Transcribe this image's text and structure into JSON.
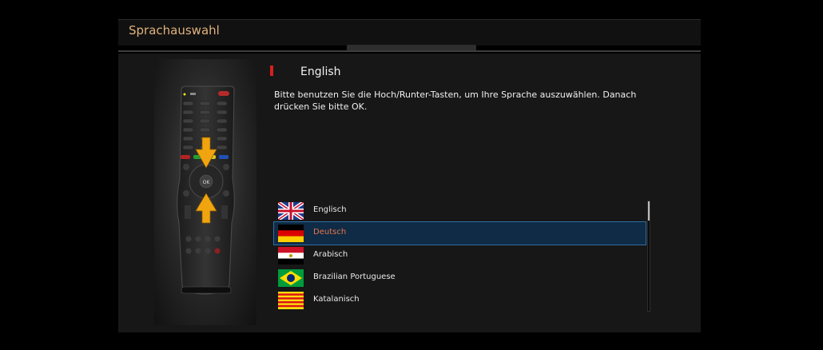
{
  "window": {
    "title": "Sprachauswahl"
  },
  "selected_language": {
    "name": "English"
  },
  "instructions": "Bitte benutzen Sie die Hoch/Runter-Tasten, um Ihre Sprache auszuwählen. Danach drücken Sie bitte OK.",
  "remote": {
    "ok_label": "OK"
  },
  "languages": [
    {
      "label": "Englisch",
      "flag": "uk-flag-icon",
      "selected": false
    },
    {
      "label": "Deutsch",
      "flag": "germany-flag-icon",
      "selected": true
    },
    {
      "label": "Arabisch",
      "flag": "egypt-flag-icon",
      "selected": false
    },
    {
      "label": "Brazilian Portuguese",
      "flag": "brazil-flag-icon",
      "selected": false
    },
    {
      "label": "Katalanisch",
      "flag": "catalonia-flag-icon",
      "selected": false
    }
  ],
  "scrollbar": {
    "position": 0
  },
  "colors": {
    "title": "#e0b27c",
    "selected_text": "#e8744a",
    "selection_bg": "#0f2b45",
    "marker": "#d62020"
  }
}
